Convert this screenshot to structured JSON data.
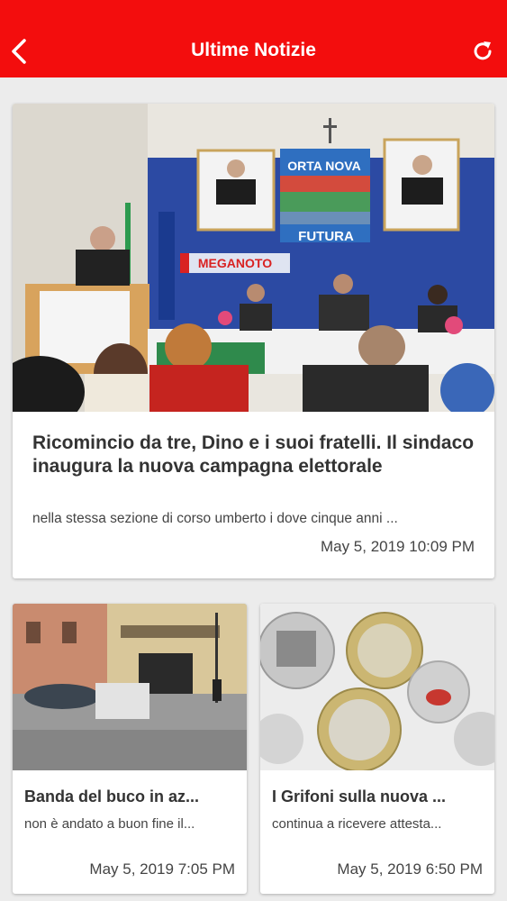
{
  "header": {
    "title": "Ultime Notizie",
    "back_icon": "chevron-left-icon",
    "refresh_icon": "refresh-icon",
    "background_color": "#f30d0d"
  },
  "featured_article": {
    "headline": "Ricomincio da tre, Dino e i suoi fratelli. Il sindaco inaugura la nuova campagna elettorale",
    "excerpt": "nella stessa sezione di corso umberto i dove cinque anni ...",
    "date": "May 5, 2019 10:09 PM",
    "image_text": {
      "banner_top": "ORTA NOVA",
      "banner_bottom": "FUTURA",
      "logo": "MEGANOTO"
    }
  },
  "articles": [
    {
      "headline": "Banda del buco in az...",
      "excerpt": "non è andato a buon fine il...",
      "date": "May 5, 2019 7:05 PM"
    },
    {
      "headline": "I Grifoni sulla nuova ...",
      "excerpt": "continua a ricevere attesta...",
      "date": "May 5, 2019 6:50 PM"
    }
  ]
}
